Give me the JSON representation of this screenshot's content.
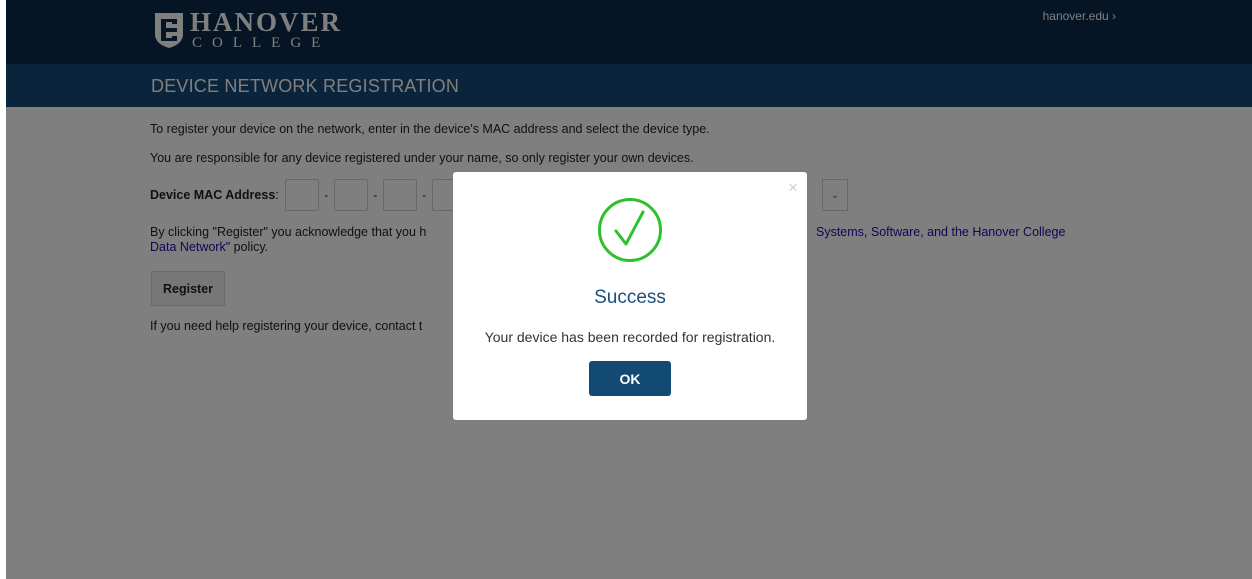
{
  "header": {
    "logo_name": "HANOVER",
    "logo_sub": "COLLEGE",
    "top_link": "hanover.edu ›",
    "title": "DEVICE NETWORK REGISTRATION"
  },
  "content": {
    "intro": "To register your device on the network, enter in the device's MAC address and select the device type.",
    "responsibility": "You are responsible for any device registered under your name, so only register your own devices.",
    "mac_label": "Device MAC Address",
    "mac_colon": ":",
    "dash": "-",
    "select_chevron": "⌄",
    "policy_start": "By clicking \"Register\" you acknowledge that you h",
    "policy_link_right": "Systems, Software, and the Hanover College",
    "policy_link_line2": "Data Network\"",
    "policy_end": " policy.",
    "register_label": "Register",
    "help_text": "If you need help registering your device, contact t"
  },
  "modal": {
    "close": "×",
    "icon": "check-circle-icon",
    "title": "Success",
    "message": "Your device has been recorded for registration.",
    "ok_label": "OK"
  },
  "colors": {
    "header": "#0b2b4b",
    "subheader": "#154a76",
    "success": "#2ec02e",
    "button": "#134a74"
  }
}
